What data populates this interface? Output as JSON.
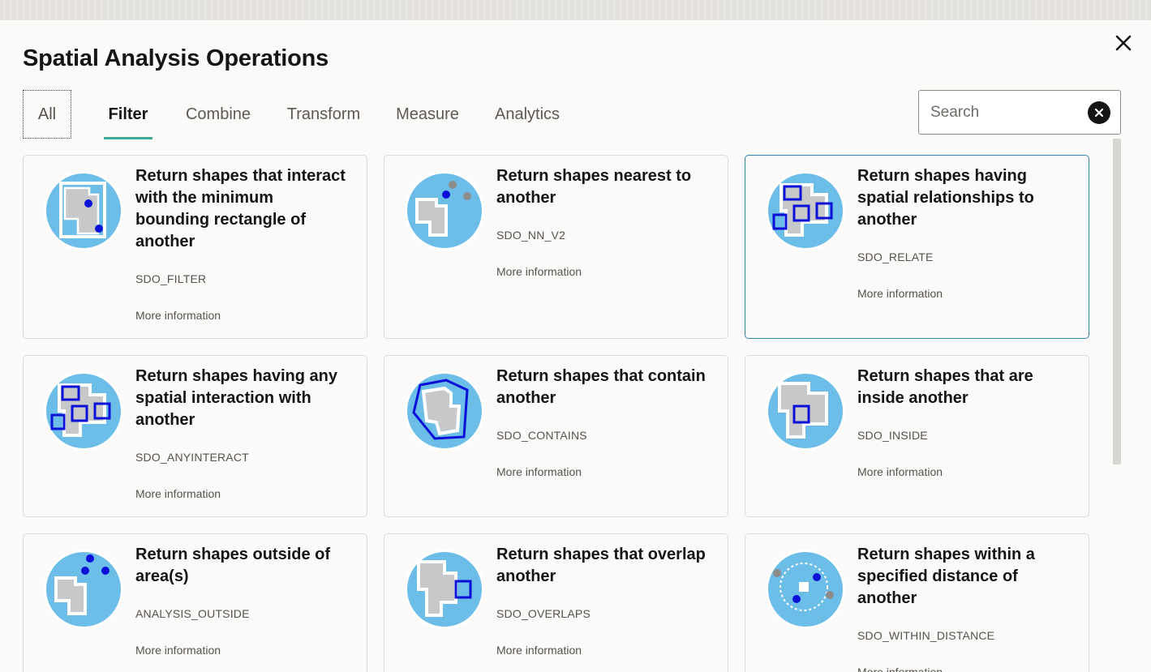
{
  "dialog": {
    "title": "Spatial Analysis Operations",
    "close_icon": "close-icon"
  },
  "tabs": [
    {
      "label": "All",
      "state": "focused"
    },
    {
      "label": "Filter",
      "state": "active"
    },
    {
      "label": "Combine",
      "state": "normal"
    },
    {
      "label": "Transform",
      "state": "normal"
    },
    {
      "label": "Measure",
      "state": "normal"
    },
    {
      "label": "Analytics",
      "state": "normal"
    }
  ],
  "search": {
    "placeholder": "Search",
    "value": "",
    "clear_icon": "clear-circle-icon"
  },
  "cards": [
    {
      "title": "Return shapes that interact with the minimum bounding rectangle of another",
      "code": "SDO_FILTER",
      "more": "More information",
      "icon": "filter-mbr-icon"
    },
    {
      "title": "Return shapes nearest to another",
      "code": "SDO_NN_V2",
      "more": "More information",
      "icon": "nearest-neighbor-icon"
    },
    {
      "title": "Return shapes having spatial relationships to another",
      "code": "SDO_RELATE",
      "more": "More information",
      "icon": "relate-icon"
    },
    {
      "title": "Return shapes having any spatial interaction with another",
      "code": "SDO_ANYINTERACT",
      "more": "More information",
      "icon": "anyinteract-icon"
    },
    {
      "title": "Return shapes that contain another",
      "code": "SDO_CONTAINS",
      "more": "More information",
      "icon": "contains-icon"
    },
    {
      "title": "Return shapes that are inside another",
      "code": "SDO_INSIDE",
      "more": "More information",
      "icon": "inside-icon"
    },
    {
      "title": "Return shapes outside of area(s)",
      "code": "ANALYSIS_OUTSIDE",
      "more": "More information",
      "icon": "outside-icon"
    },
    {
      "title": "Return shapes that overlap another",
      "code": "SDO_OVERLAPS",
      "more": "More information",
      "icon": "overlaps-icon"
    },
    {
      "title": "Return shapes within a specified distance of another",
      "code": "SDO_WITHIN_DISTANCE",
      "more": "More information",
      "icon": "within-distance-icon"
    }
  ],
  "colors": {
    "icon_circle": "#6cbde8",
    "shape_fill": "#c6c8ca",
    "shape_outline": "#ffffff",
    "accent_blue": "#0a10d8",
    "point_gray": "#8c8c8c",
    "tab_underline": "#3fa99a",
    "selected_border": "#2e84b5"
  }
}
